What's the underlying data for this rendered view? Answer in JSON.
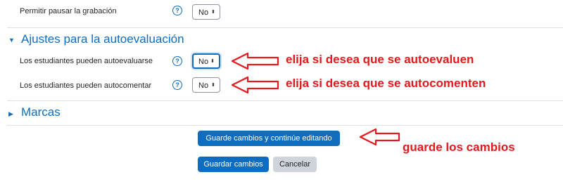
{
  "rows": {
    "pause": {
      "label": "Permitir pausar la grabación",
      "value": "No"
    },
    "self_eval": {
      "label": "Los estudiantes pueden autoevaluarse",
      "value": "No"
    },
    "self_comment": {
      "label": "Los estudiantes pueden autocomentar",
      "value": "No"
    }
  },
  "help_glyph": "?",
  "sections": {
    "self_assessment": {
      "title": "Ajustes para la autoevaluación",
      "toggle": "▼"
    },
    "marks": {
      "title": "Marcas",
      "toggle": "▶"
    }
  },
  "buttons": {
    "save_continue": "Guarde cambios y continúe editando",
    "save": "Guardar cambios",
    "cancel": "Cancelar"
  },
  "annotations": {
    "self_eval": "elija si desea que se autoevaluen",
    "self_comment": "elija si desea que se autocomenten",
    "save": "guarde los cambios"
  },
  "colors": {
    "accent": "#0f6cbf",
    "annotation": "#e3191d"
  }
}
